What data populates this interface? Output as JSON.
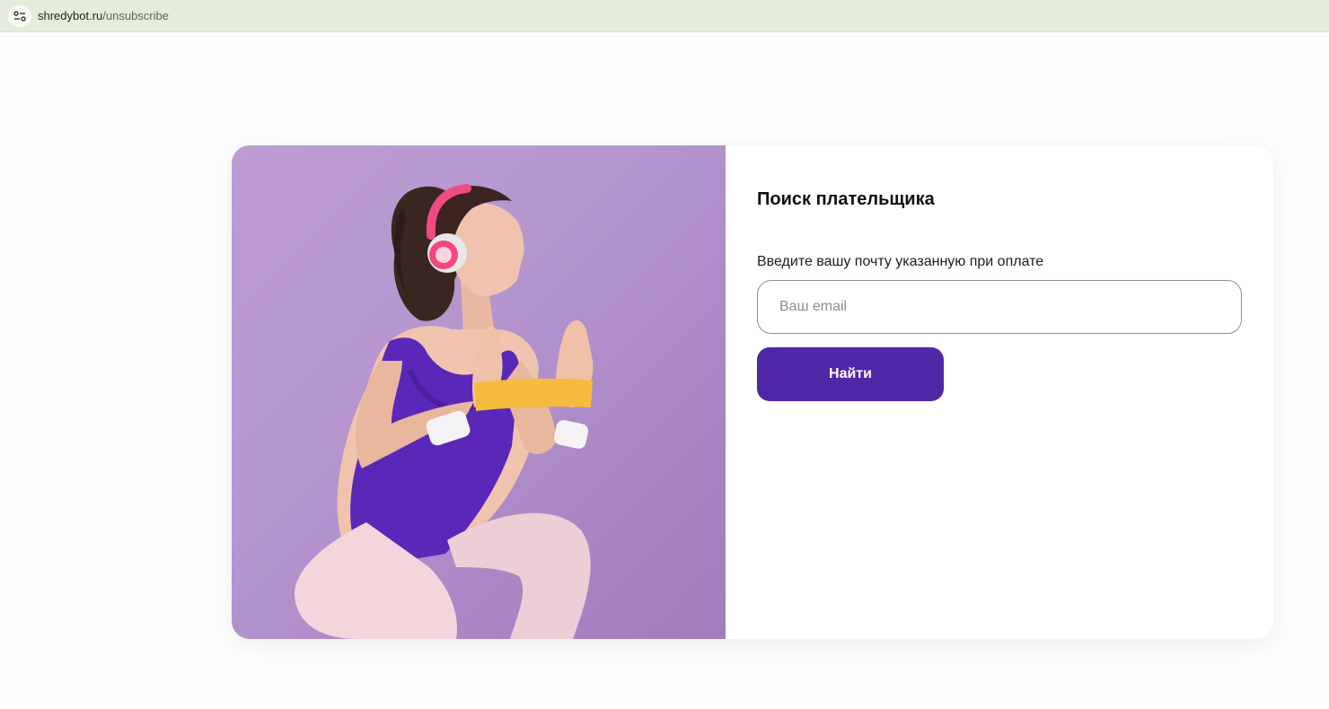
{
  "browser": {
    "url_host": "shredybot.ru",
    "url_path": "/unsubscribe",
    "site_info_icon": "tune-icon"
  },
  "page": {
    "image_alt": "Девушка в наушниках выполняет упражнение с резинкой",
    "form": {
      "title": "Поиск плательщика",
      "label": "Введите вашу почту указанную при оплате",
      "email_placeholder": "Ваш email",
      "email_value": "",
      "submit_label": "Найти"
    }
  },
  "colors": {
    "accent": "#5027a6",
    "photo_background": "#b596cf",
    "addressbar": "#e4eddb"
  }
}
